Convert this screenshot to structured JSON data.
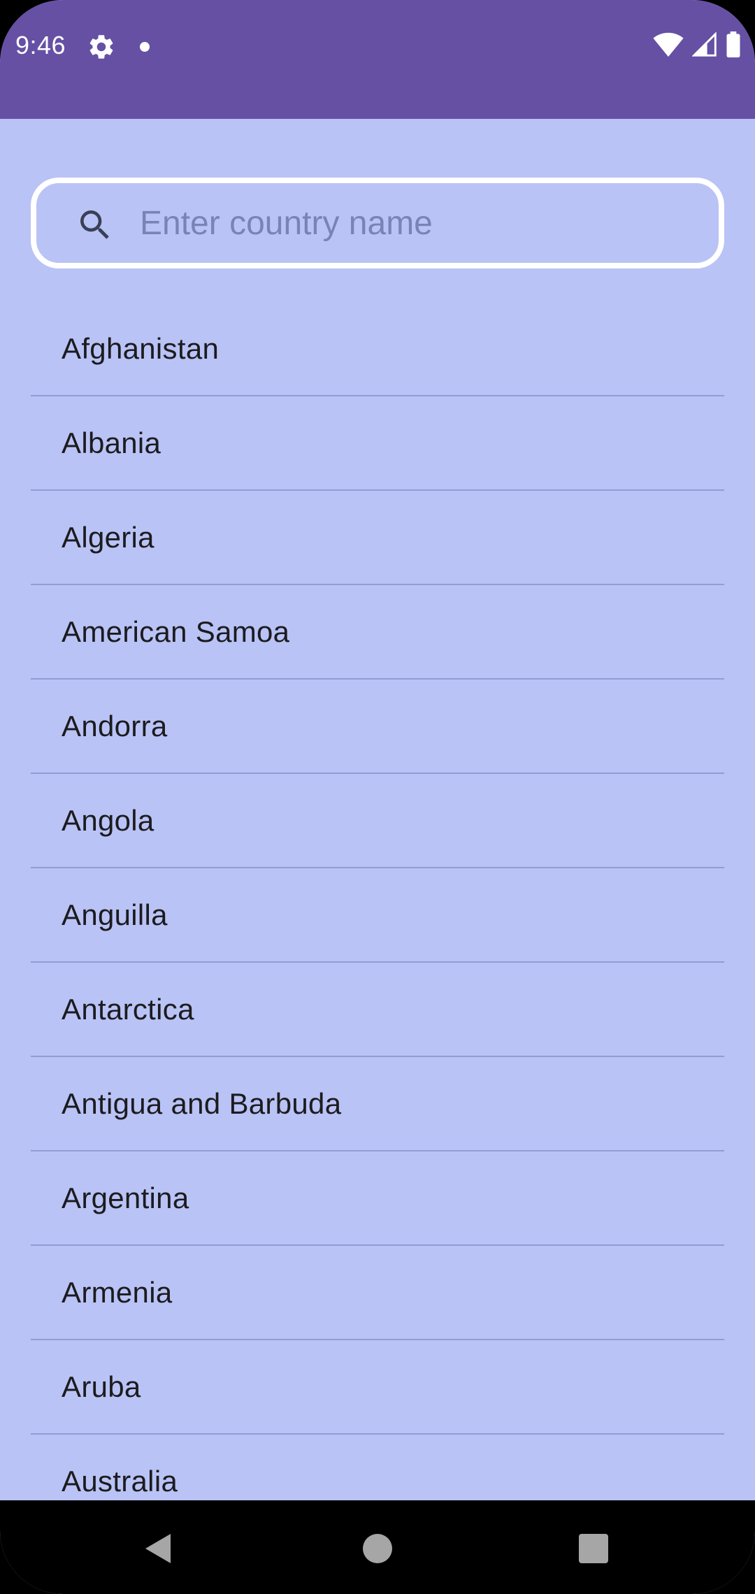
{
  "status_bar": {
    "time": "9:46",
    "icons": [
      "gear-icon",
      "notification-dot-icon",
      "wifi-icon",
      "signal-icon",
      "battery-icon"
    ],
    "background_color": "#6650a4"
  },
  "search": {
    "placeholder": "Enter country name",
    "value": "",
    "icon": "search-icon"
  },
  "countries": [
    "Afghanistan",
    "Albania",
    "Algeria",
    "American Samoa",
    "Andorra",
    "Angola",
    "Anguilla",
    "Antarctica",
    "Antigua and Barbuda",
    "Argentina",
    "Armenia",
    "Aruba",
    "Australia"
  ],
  "nav_bar": {
    "icons": [
      "back-icon",
      "home-icon",
      "recents-icon"
    ]
  },
  "colors": {
    "background": "#b9c3f5",
    "accent": "#6650a4",
    "divider": "#939cd3",
    "text": "#1c1b1f"
  }
}
